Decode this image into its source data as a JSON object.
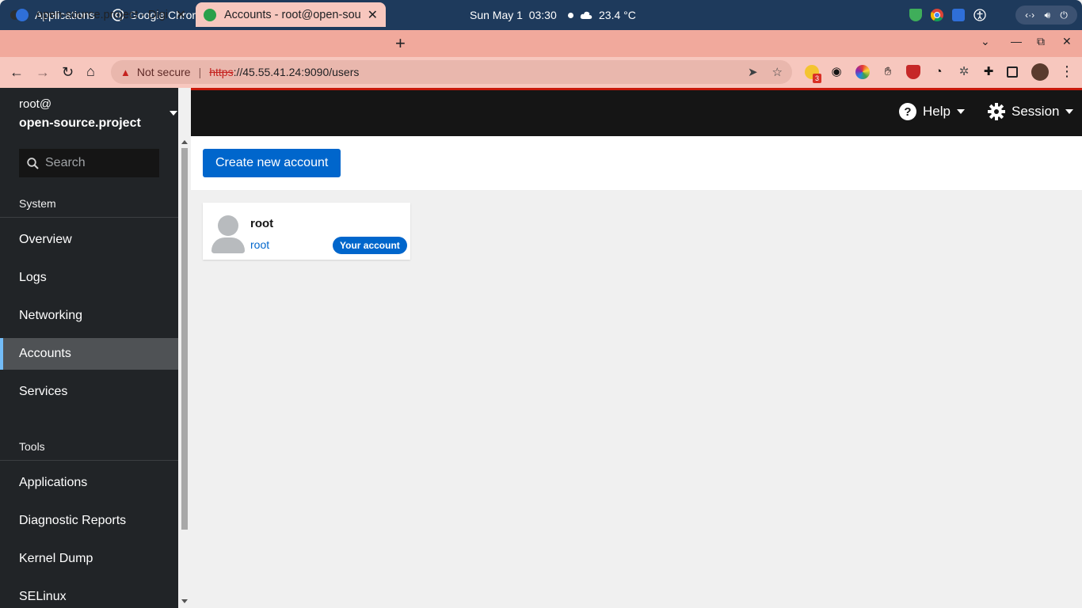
{
  "os_bar": {
    "applications": "Applications",
    "active_app": "Google Chrome",
    "clock": "Sun May 1  03:30",
    "weather": "23.4 °C"
  },
  "browser": {
    "tabs": [
      {
        "title": "open-source.project - Digi",
        "favicon_color": "#2f6fd8"
      },
      {
        "title": "Accounts - root@open-sou",
        "favicon_color": "#2aa04a"
      }
    ],
    "not_secure": "Not secure",
    "url_scheme": "https",
    "url_rest": "://45.55.41.24:9090/users",
    "extension_badge": "3"
  },
  "host": {
    "user": "root@",
    "name": "open-source.project"
  },
  "sidebar": {
    "search_placeholder": "Search",
    "system_heading": "System",
    "system_items": [
      "Overview",
      "Logs",
      "Networking",
      "Accounts",
      "Services"
    ],
    "active_item": "Accounts",
    "tools_heading": "Tools",
    "tools_items": [
      "Applications",
      "Diagnostic Reports",
      "Kernel Dump",
      "SELinux"
    ]
  },
  "topbar": {
    "help": "Help",
    "session": "Session"
  },
  "toolbar": {
    "create_button": "Create new account"
  },
  "accounts": [
    {
      "name": "root",
      "login": "root",
      "badge": "Your account"
    }
  ],
  "colors": {
    "accent": "#0066cc",
    "sidebar_bg": "#212427",
    "active_border": "#73bcf7",
    "topbar_red_line": "#c9190b",
    "tab_strip": "#f1a99c"
  }
}
